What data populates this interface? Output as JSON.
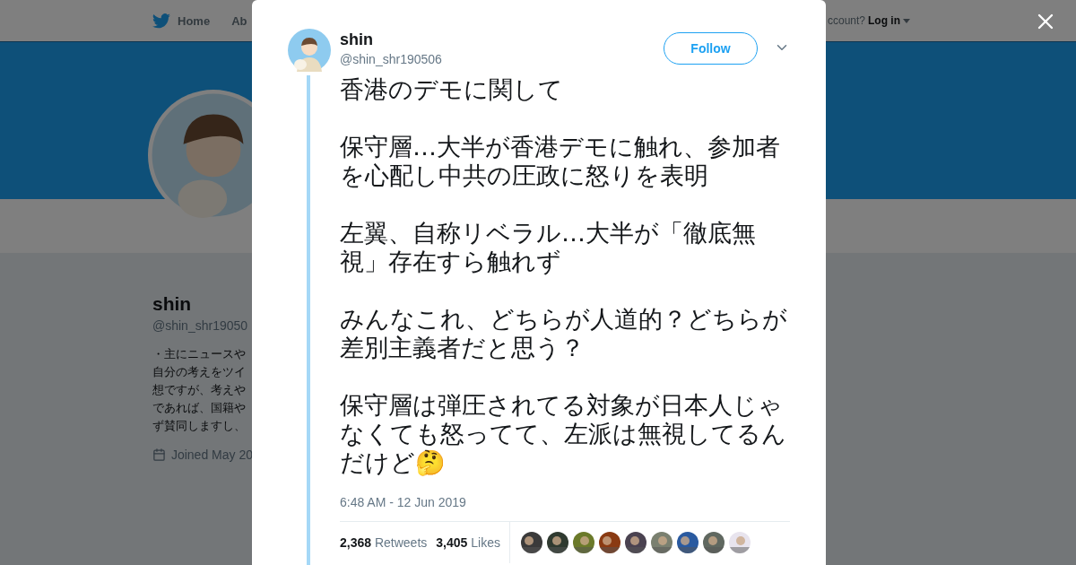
{
  "nav": {
    "items": [
      "Home",
      "Ab"
    ],
    "account_prompt": "ccount?",
    "login": "Log in"
  },
  "profile": {
    "name": "shin",
    "handle": "@shin_shr19050",
    "bio": [
      "・主にニュースや",
      "自分の考えをツイ",
      "想ですが、考えや",
      "であれば、国籍や",
      "ず賛同しますし、"
    ],
    "joined": "Joined May 20"
  },
  "tweet": {
    "name": "shin",
    "handle": "@shin_shr190506",
    "follow": "Follow",
    "paragraphs": [
      "香港のデモに関して",
      "保守層…大半が香港デモに触れ、参加者を心配し中共の圧政に怒りを表明",
      "左翼、自称リベラル…大半が「徹底無視」存在すら触れず",
      "みんなこれ、どちらが人道的？どちらが差別主義者だと思う？",
      "保守層は弾圧されてる対象が日本人じゃなくても怒ってて、左派は無視してるんだけど🤔"
    ],
    "timestamp": "6:48 AM - 12 Jun 2019",
    "stats": [
      {
        "count": "2,368",
        "label": "Retweets"
      },
      {
        "count": "3,405",
        "label": "Likes"
      }
    ],
    "likers": [
      {
        "color": "#3a3a3a"
      },
      {
        "color": "#2f3a30"
      },
      {
        "color": "#6b7a2a"
      },
      {
        "color": "#8a3a12"
      },
      {
        "color": "#4a4250"
      },
      {
        "color": "#7a8070"
      },
      {
        "color": "#2a5aa0"
      },
      {
        "color": "#606860"
      },
      {
        "color": "#e8e4ee"
      }
    ]
  }
}
